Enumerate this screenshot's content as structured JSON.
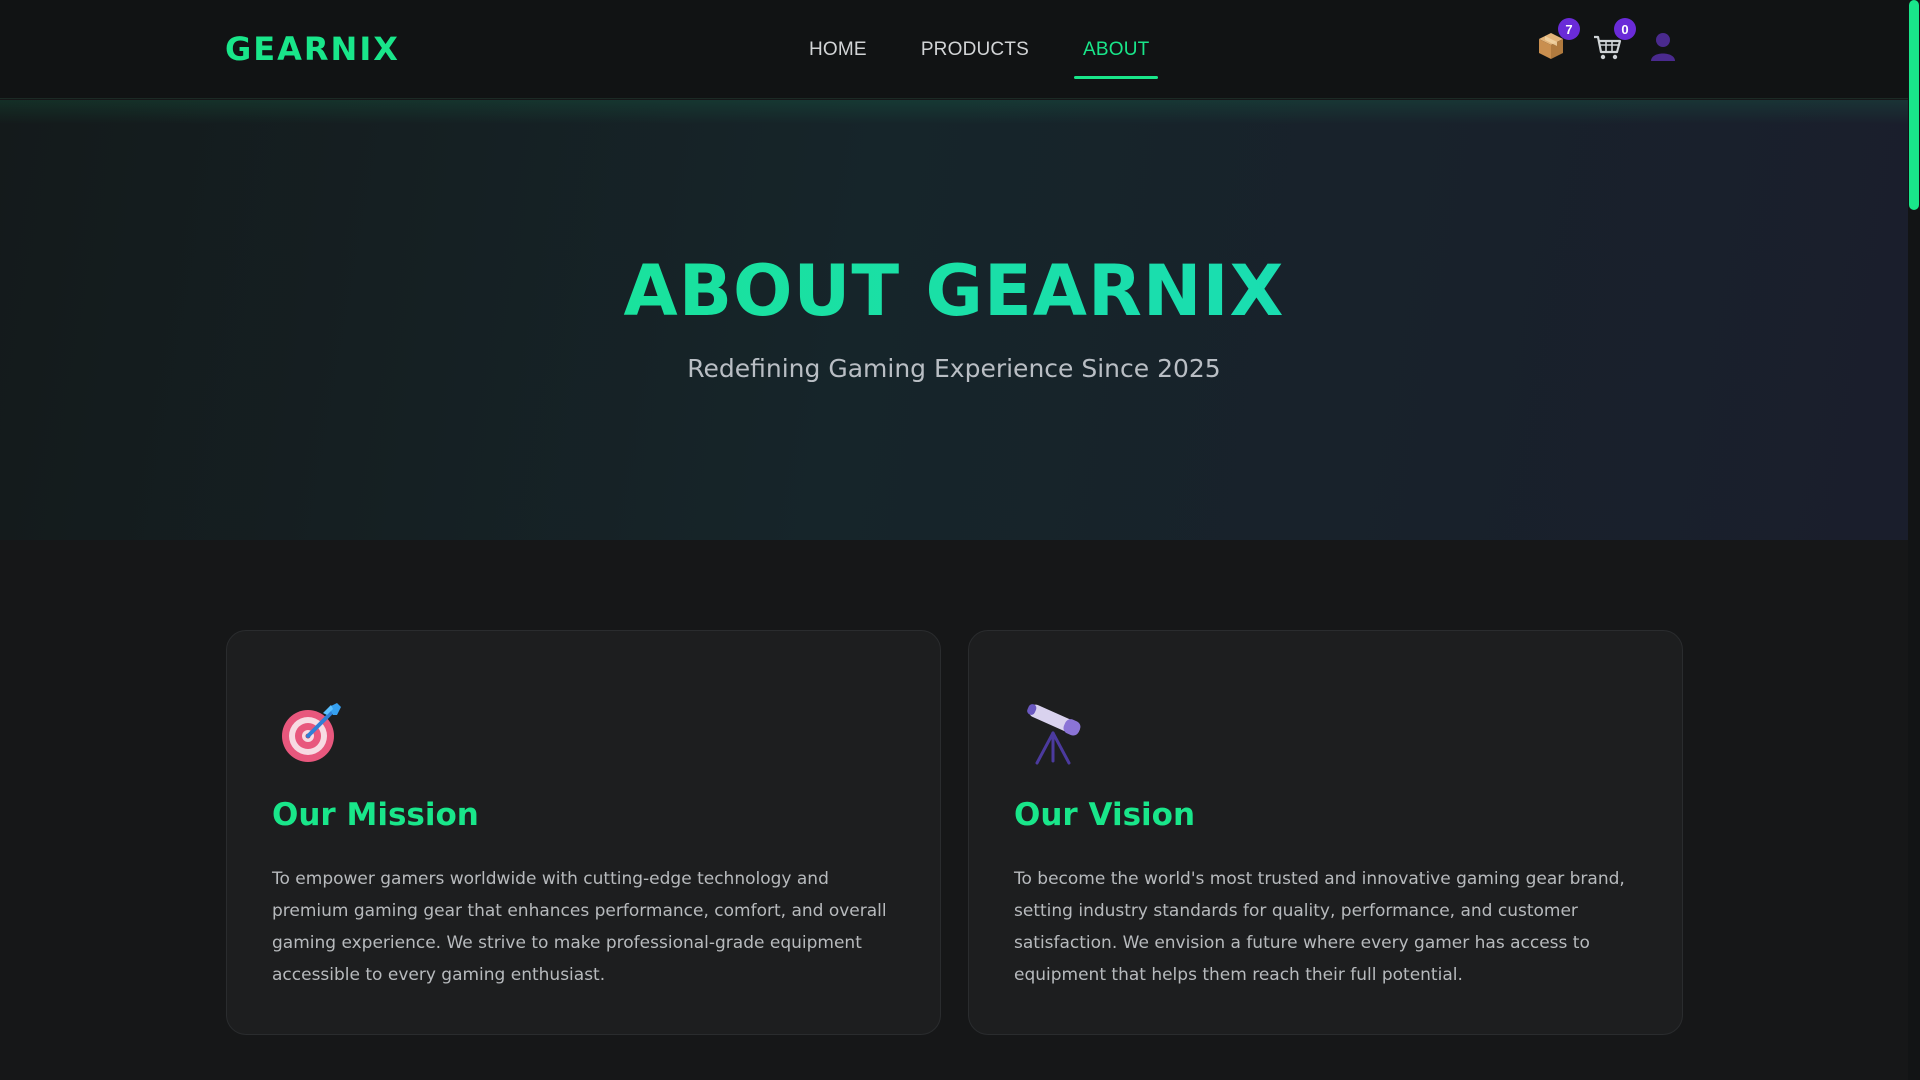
{
  "brand": {
    "logo": "GEARNIX",
    "accent": "#19e68a",
    "badge_color": "#6a2bd8"
  },
  "nav": {
    "links": [
      {
        "label": "HOME",
        "active": false
      },
      {
        "label": "PRODUCTS",
        "active": false
      },
      {
        "label": "ABOUT",
        "active": true
      }
    ],
    "icons": [
      {
        "name": "package-icon",
        "badge": "7"
      },
      {
        "name": "cart-icon",
        "badge": "0"
      },
      {
        "name": "user-icon"
      }
    ]
  },
  "hero": {
    "title": "ABOUT GEARNIX",
    "subtitle": "Redefining Gaming Experience Since 2025"
  },
  "cards": [
    {
      "icon": "target-icon",
      "title": "Our Mission",
      "text": "To empower gamers worldwide with cutting-edge technology and premium gaming gear that enhances performance, comfort, and overall gaming experience. We strive to make professional-grade equipment accessible to every gaming enthusiast."
    },
    {
      "icon": "telescope-icon",
      "title": "Our Vision",
      "text": "To become the world's most trusted and innovative gaming gear brand, setting industry standards for quality, performance, and customer satisfaction. We envision a future where every gamer has access to equipment that helps them reach their full potential."
    }
  ]
}
